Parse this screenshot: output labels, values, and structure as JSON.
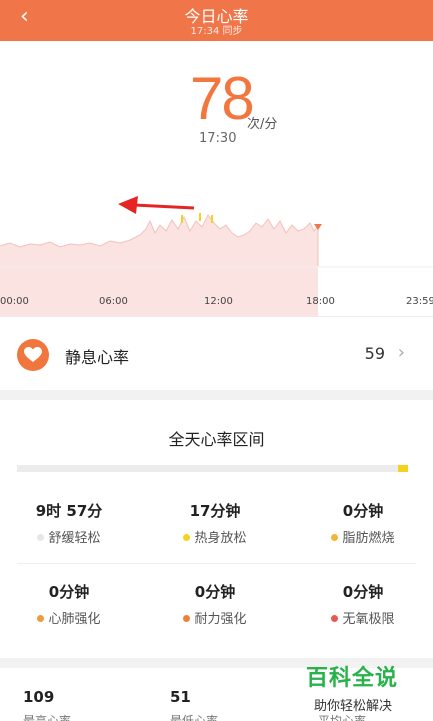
{
  "header": {
    "back_icon": "chevron-left-icon",
    "title": "今日心率",
    "subtitle": "17:34 同步",
    "color": "#f0764a"
  },
  "summary": {
    "bpm": "78",
    "unit": "次/分",
    "time": "17:30"
  },
  "chart_data": {
    "type": "area",
    "x_ticks": [
      "00:00",
      "06:00",
      "12:00",
      "18:00",
      "23:59"
    ],
    "series_color": "#f5c7c2",
    "marker_color": "#f0764a",
    "annotation": "red arrow pointing left"
  },
  "resting": {
    "icon": "heart-icon",
    "label": "静息心率",
    "value": "59"
  },
  "zones": {
    "title": "全天心率区间",
    "items": [
      {
        "value": "9时 57分",
        "label": "舒缓轻松",
        "color": "#e6e6e6"
      },
      {
        "value": "17分钟",
        "label": "热身放松",
        "color": "#f6d21e"
      },
      {
        "value": "0分钟",
        "label": "脂肪燃烧",
        "color": "#f2b43a"
      },
      {
        "value": "0分钟",
        "label": "心肺强化",
        "color": "#f19a3a"
      },
      {
        "value": "0分钟",
        "label": "耐力强化",
        "color": "#ef8135"
      },
      {
        "value": "0分钟",
        "label": "无氧极限",
        "color": "#e85a4f"
      }
    ]
  },
  "bottom": {
    "items": [
      {
        "value": "109",
        "label": "最高心率"
      },
      {
        "value": "51",
        "label": "最低心率"
      },
      {
        "value": "",
        "label": "平均心率"
      }
    ]
  },
  "watermark": {
    "big": "百科全说",
    "small": "助你轻松解决"
  }
}
